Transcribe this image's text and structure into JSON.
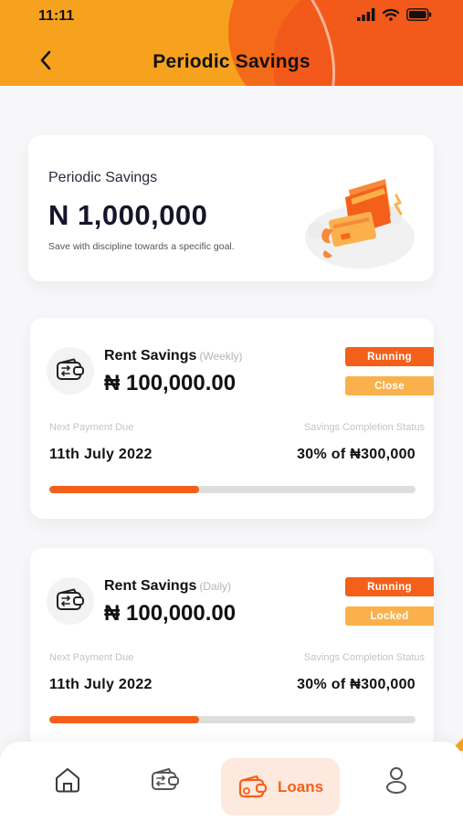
{
  "status_bar": {
    "time": "11:11"
  },
  "header": {
    "title": "Periodic Savings"
  },
  "summary": {
    "label": "Periodic Savings",
    "amount": "N 1,000,000",
    "description": "Save with discipline towards a specific goal."
  },
  "plans": [
    {
      "name": "Rent Savings",
      "frequency": "(Weekly)",
      "amount": "₦ 100,000.00",
      "status": "Running",
      "action": "Close",
      "next_payment_label": "Next Payment Due",
      "next_payment": "11th July 2022",
      "completion_label": "Savings Completion Status",
      "completion": "30% of ₦300,000",
      "progress": 0.41
    },
    {
      "name": "Rent Savings",
      "frequency": "(Daily)",
      "amount": "₦ 100,000.00",
      "status": "Running",
      "action": "Locked",
      "next_payment_label": "Next Payment Due",
      "next_payment": "11th July 2022",
      "completion_label": "Savings Completion Status",
      "completion": "30% of ₦300,000",
      "progress": 0.41
    }
  ],
  "nav": {
    "items": [
      {
        "icon": "home-icon"
      },
      {
        "icon": "wallet-icon"
      },
      {
        "icon": "loans-icon",
        "label": "Loans",
        "active": true
      },
      {
        "icon": "profile-icon"
      }
    ]
  },
  "colors": {
    "primary": "#f4601a",
    "accent": "#f7a21e",
    "badge_secondary": "#fbb14b",
    "track": "#dedede"
  }
}
